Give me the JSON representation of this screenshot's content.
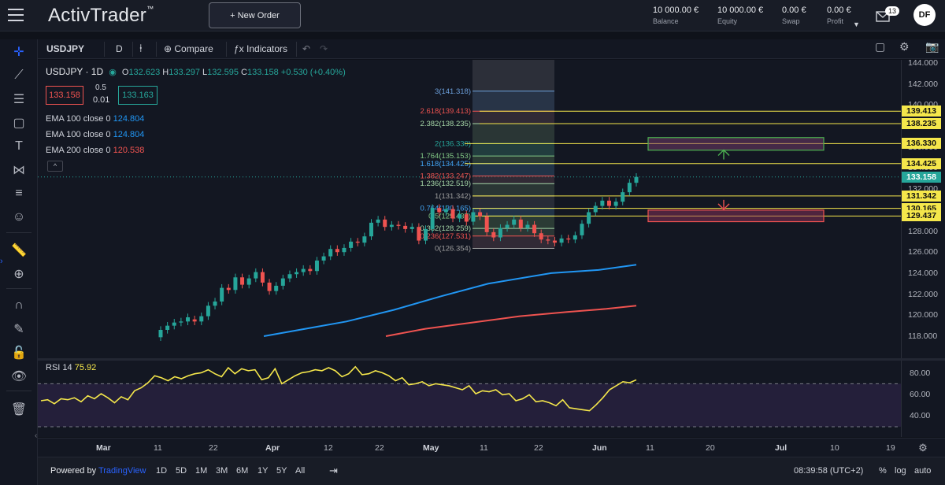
{
  "app": {
    "logo": "ActivTrader",
    "logo_tm": "™",
    "new_order": "+ New Order"
  },
  "stats": [
    {
      "value": "10 000.00 €",
      "label": "Balance"
    },
    {
      "value": "10 000.00 €",
      "label": "Equity"
    },
    {
      "value": "0.00 €",
      "label": "Swap"
    },
    {
      "value": "0.00 €",
      "label": "Profit"
    }
  ],
  "notifications": "13",
  "avatar": "DF",
  "toolbar": {
    "symbol": "USDJPY",
    "interval": "D",
    "compare": "Compare",
    "indicators": "Indicators"
  },
  "legend": {
    "symbol": "USDJPY · 1D",
    "o_label": "O",
    "o": "132.623",
    "h_label": "H",
    "h": "133.297",
    "l_label": "L",
    "l": "132.595",
    "c_label": "C",
    "c": "133.158",
    "change": "+0.530 (+0.40%)",
    "sell": "133.158",
    "buy": "133.163",
    "spread_top": "0.5",
    "spread_bot": "0.01"
  },
  "emas": [
    {
      "label": "EMA 100 close 0",
      "value": "124.804",
      "color": "#2196f3"
    },
    {
      "label": "EMA 100 close 0",
      "value": "124.804",
      "color": "#2196f3"
    },
    {
      "label": "EMA 200 close 0",
      "value": "120.538",
      "color": "#ef5350"
    }
  ],
  "collapse": "^",
  "rsi": {
    "label": "RSI 14",
    "value": "75.92",
    "ticks": [
      "80.00",
      "60.00",
      "40.00"
    ]
  },
  "yticks": [
    "144.000",
    "142.000",
    "140.000",
    "138.000",
    "136.000",
    "134.000",
    "132.000",
    "130.000",
    "128.000",
    "126.000",
    "124.000",
    "122.000",
    "120.000",
    "118.000"
  ],
  "price_labels": [
    {
      "text": "139.413",
      "price": 139.413,
      "color": "#f5e74b"
    },
    {
      "text": "138.235",
      "price": 138.235,
      "color": "#f5e74b"
    },
    {
      "text": "136.330",
      "price": 136.33,
      "color": "#f5e74b"
    },
    {
      "text": "134.425",
      "price": 134.425,
      "color": "#f5e74b"
    },
    {
      "text": "133.158",
      "price": 133.158,
      "color": "#26a69a"
    },
    {
      "text": "131.342",
      "price": 131.342,
      "color": "#f5e74b"
    },
    {
      "text": "130.165",
      "price": 130.165,
      "color": "#f5e74b"
    },
    {
      "text": "129.437",
      "price": 129.437,
      "color": "#f5e74b"
    }
  ],
  "fib_levels": [
    {
      "text": "3(141.318)",
      "price": 141.318,
      "color": "#6ca0dc"
    },
    {
      "text": "2.618(139.413)",
      "price": 139.413,
      "color": "#ef5350"
    },
    {
      "text": "2.382(138.235)",
      "price": 138.235,
      "color": "#a5d6a7"
    },
    {
      "text": "2(136.330)",
      "price": 136.33,
      "color": "#26a69a"
    },
    {
      "text": "1.764(135.153)",
      "price": 135.153,
      "color": "#81c784"
    },
    {
      "text": "1.618(134.425)",
      "price": 134.425,
      "color": "#42a5f5"
    },
    {
      "text": "1.382(133.247)",
      "price": 133.247,
      "color": "#ef5350"
    },
    {
      "text": "1.236(132.519)",
      "price": 132.519,
      "color": "#a5d6a7"
    },
    {
      "text": "1(131.342)",
      "price": 131.342,
      "color": "#9e9e9e"
    },
    {
      "text": "0.764(130.165)",
      "price": 130.165,
      "color": "#42a5f5"
    },
    {
      "text": "0.5(129.437)",
      "price": 129.437,
      "color": "#81c784"
    },
    {
      "text": "0.382(128.259)",
      "price": 128.259,
      "color": "#a5d6a7"
    },
    {
      "text": "0.236(127.531)",
      "price": 127.531,
      "color": "#ef5350"
    },
    {
      "text": "0(126.354)",
      "price": 126.354,
      "color": "#9e9e9e"
    }
  ],
  "xaxis": [
    {
      "t": "Mar",
      "m": true
    },
    {
      "t": "11"
    },
    {
      "t": "22"
    },
    {
      "t": "Apr",
      "m": true
    },
    {
      "t": "12"
    },
    {
      "t": "22"
    },
    {
      "t": "May",
      "m": true
    },
    {
      "t": "11"
    },
    {
      "t": "22"
    },
    {
      "t": "Jun",
      "m": true
    },
    {
      "t": "11"
    },
    {
      "t": "20"
    },
    {
      "t": "Jul",
      "m": true
    },
    {
      "t": "10"
    },
    {
      "t": "19"
    }
  ],
  "bottom": {
    "powered": "Powered by",
    "tv": "TradingView",
    "ranges": [
      "1D",
      "5D",
      "1M",
      "3M",
      "6M",
      "1Y",
      "5Y",
      "All"
    ],
    "time": "08:39:58 (UTC+2)",
    "pct": "%",
    "log": "log",
    "auto": "auto"
  },
  "colors": {
    "up": "#26a69a",
    "down": "#ef5350",
    "ema100": "#2196f3",
    "ema200": "#ef5350",
    "rsi": "#f5e74b",
    "accent": "#f5e74b"
  }
}
